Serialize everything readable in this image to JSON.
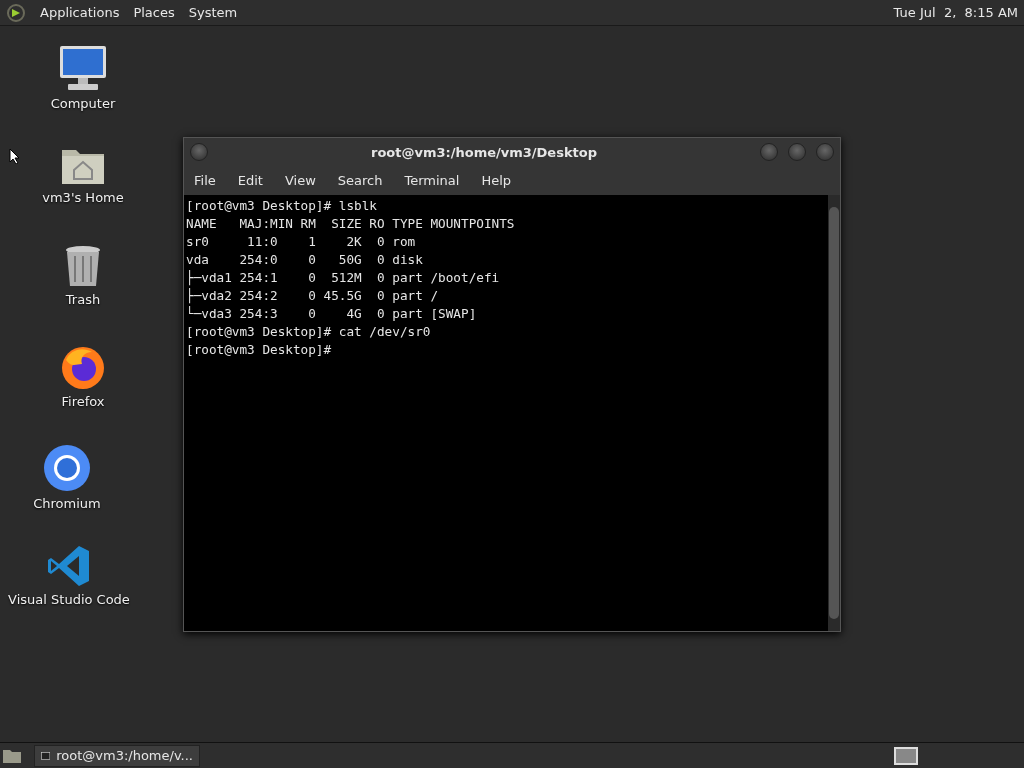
{
  "top_panel": {
    "menus": [
      "Applications",
      "Places",
      "System"
    ],
    "clock": "Tue Jul  2,  8:15 AM"
  },
  "desktop_icons": [
    {
      "kind": "computer",
      "label": "Computer"
    },
    {
      "kind": "home",
      "label": "vm3's Home"
    },
    {
      "kind": "trash",
      "label": "Trash"
    },
    {
      "kind": "firefox",
      "label": "Firefox"
    },
    {
      "kind": "chromium",
      "label": "Chromium"
    },
    {
      "kind": "vscode",
      "label": "Visual Studio Code"
    }
  ],
  "terminal_window": {
    "title": "root@vm3:/home/vm3/Desktop",
    "menu": [
      "File",
      "Edit",
      "View",
      "Search",
      "Terminal",
      "Help"
    ],
    "lines": [
      "[root@vm3 Desktop]# lsblk",
      "NAME   MAJ:MIN RM  SIZE RO TYPE MOUNTPOINTS",
      "sr0     11:0    1    2K  0 rom",
      "vda    254:0    0   50G  0 disk",
      "├─vda1 254:1    0  512M  0 part /boot/efi",
      "├─vda2 254:2    0 45.5G  0 part /",
      "└─vda3 254:3    0    4G  0 part [SWAP]",
      "[root@vm3 Desktop]# cat /dev/sr0",
      "[root@vm3 Desktop]#"
    ]
  },
  "taskbar": {
    "tasks": [
      {
        "label": "root@vm3:/home/v...",
        "selected": false
      }
    ]
  }
}
